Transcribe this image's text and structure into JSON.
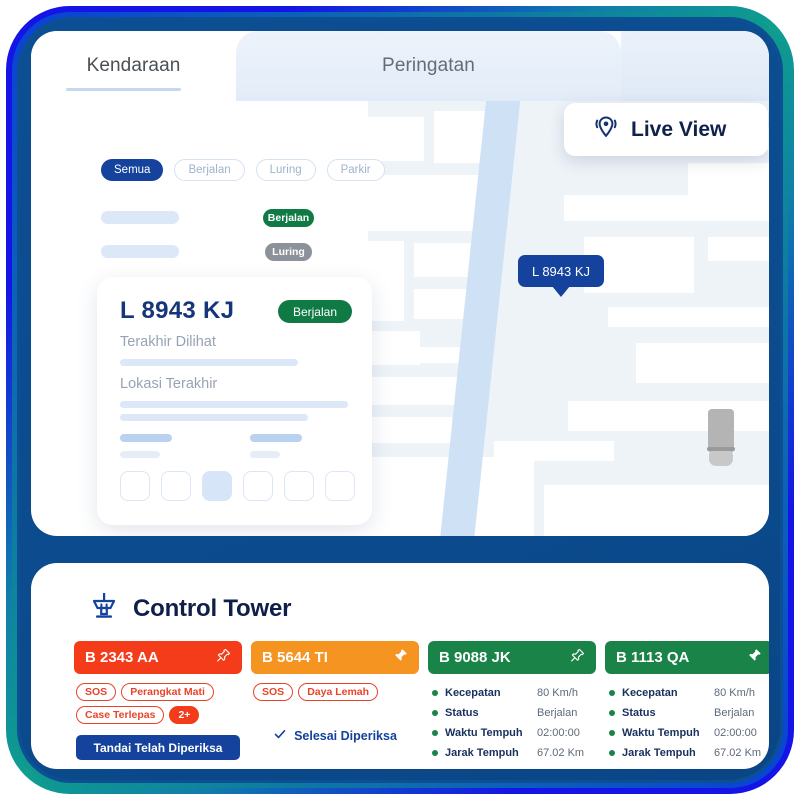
{
  "frame": {
    "ring_outer_blue": "#1414e6",
    "ring_teal": "#0e9f8f",
    "ring_navy": "#0c4e93"
  },
  "top_panel": {
    "tabs": [
      {
        "label": "Kendaraan",
        "active": true
      },
      {
        "label": "Peringatan",
        "active": false
      }
    ],
    "filters": [
      {
        "label": "Semua",
        "selected": true
      },
      {
        "label": "Berjalan",
        "selected": false
      },
      {
        "label": "Luring",
        "selected": false
      },
      {
        "label": "Parkir",
        "selected": false
      }
    ],
    "list_status": [
      {
        "label": "Berjalan",
        "tone": "running"
      },
      {
        "label": "Luring",
        "tone": "offline"
      }
    ],
    "live_view": {
      "label": "Live View",
      "icon": "live-location-pin-icon"
    }
  },
  "detail_card": {
    "plate": "L 8943 KJ",
    "status_badge": "Berjalan",
    "label_last_seen": "Terakhir Dilihat",
    "label_last_location": "Lokasi Terakhir",
    "action_count": 6,
    "active_action_index": 2
  },
  "map": {
    "marker_label": "L 8943 KJ",
    "vehicle_color": "#17a84a",
    "idle_vehicle_color": "#a8a8a8",
    "halo_color": "#6094d8",
    "road_color": "#ffffff",
    "river_color": "#cfe2f5",
    "background": "#eef3f8"
  },
  "control_tower": {
    "icon": "control-tower-icon",
    "title": "Control Tower",
    "cards": [
      {
        "plate": "B 2343 AA",
        "tone": "critical",
        "header_color": "#f43b1a",
        "pin_state": "outline",
        "tags": [
          {
            "label": "SOS",
            "style": "outline"
          },
          {
            "label": "Perangkat Mati",
            "style": "outline"
          },
          {
            "label": "Case Terlepas",
            "style": "outline"
          },
          {
            "label": "2+",
            "style": "solid"
          }
        ],
        "action_label": "Tandai Telah Diperiksa"
      },
      {
        "plate": "B 5644 TI",
        "tone": "warning",
        "header_color": "#f59421",
        "pin_state": "filled",
        "tags": [
          {
            "label": "SOS",
            "style": "outline"
          },
          {
            "label": "Daya Lemah",
            "style": "outline"
          }
        ],
        "done_label": "Selesai Diperiksa"
      },
      {
        "plate": "B 9088 JK",
        "tone": "ok",
        "header_color": "#1a8348",
        "pin_state": "outline",
        "metrics": [
          {
            "key": "Kecepatan",
            "value": "80 Km/h"
          },
          {
            "key": "Status",
            "value": "Berjalan"
          },
          {
            "key": "Waktu Tempuh",
            "value": "02:00:00"
          },
          {
            "key": "Jarak Tempuh",
            "value": "67.02 Km"
          }
        ]
      },
      {
        "plate": "B 1113 QA",
        "tone": "ok",
        "header_color": "#1a8348",
        "pin_state": "filled",
        "metrics": [
          {
            "key": "Kecepatan",
            "value": "80 Km/h"
          },
          {
            "key": "Status",
            "value": "Berjalan"
          },
          {
            "key": "Waktu Tempuh",
            "value": "02:00:00"
          },
          {
            "key": "Jarak Tempuh",
            "value": "67.02 Km"
          }
        ]
      }
    ]
  }
}
